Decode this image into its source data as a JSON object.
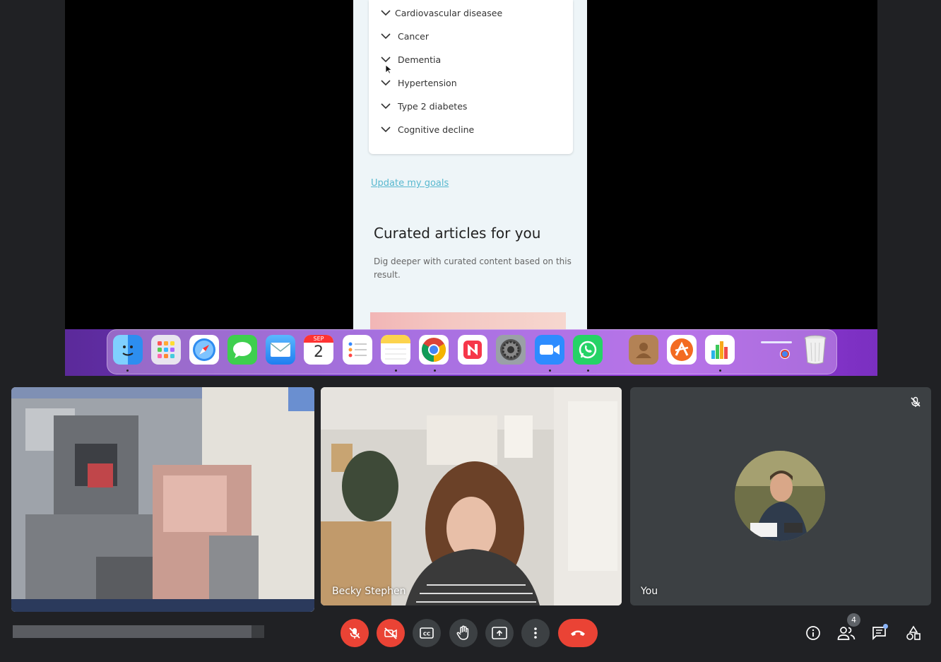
{
  "shared_screen": {
    "conditions": [
      "Cardiovascular diseasee",
      "Cancer",
      "Dementia",
      "Hypertension",
      "Type 2 diabetes",
      "Cognitive decline"
    ],
    "update_link": "Update my goals",
    "articles_title": "Curated articles for you",
    "articles_description": "Dig deeper with curated content based on this result."
  },
  "dock": {
    "calendar_month": "SEP",
    "calendar_day": "2",
    "apps": [
      "finder-icon",
      "launchpad-icon",
      "safari-icon",
      "messages-icon",
      "mail-icon",
      "calendar-icon",
      "reminders-icon",
      "notes-icon",
      "chrome-icon",
      "news-icon",
      "system-settings-icon",
      "zoom-icon",
      "whatsapp-icon",
      "contacts-icon",
      "app-icon",
      "numbers-icon",
      "downloads-stack-icon",
      "trash-icon"
    ]
  },
  "participants": {
    "becky_name": "Becky Stephen",
    "self_name": "You"
  },
  "controls": {
    "people_count": "4"
  },
  "colors": {
    "accent_red": "#ea4335",
    "link": "#58b8cf",
    "tile_bg": "#3c4043"
  }
}
